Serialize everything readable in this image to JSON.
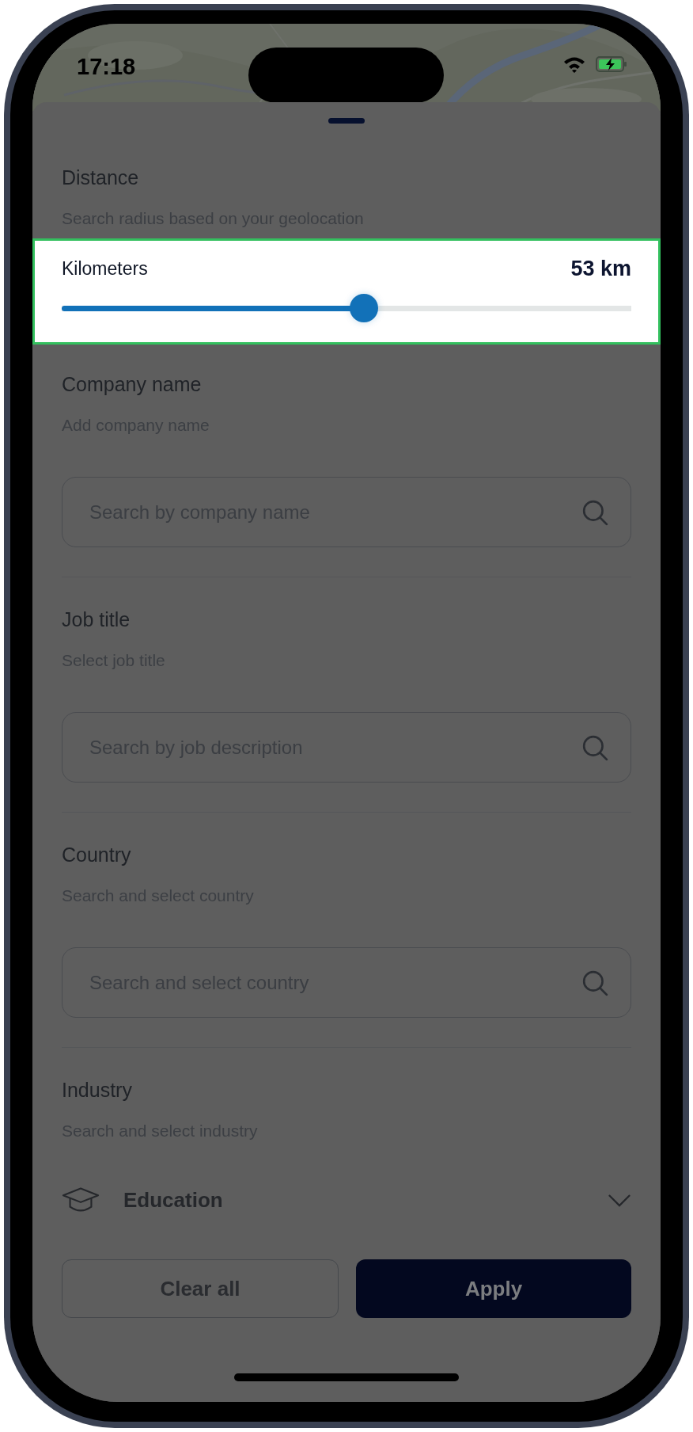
{
  "status_bar": {
    "time": "17:18"
  },
  "sections": [
    {
      "kind": "slider",
      "title": "Distance",
      "subtitle": "Search radius based on your geolocation",
      "slider": {
        "label": "Kilometers",
        "reading": "53 km",
        "level": 0.53,
        "highlighted": true
      }
    },
    {
      "kind": "search",
      "title": "Company name",
      "subtitle": "Add company name",
      "placeholder": "Search by company name"
    },
    {
      "kind": "search",
      "title": "Job title",
      "subtitle": "Select job title",
      "placeholder": "Search by job description"
    },
    {
      "kind": "search",
      "title": "Country",
      "subtitle": "Search and select country",
      "placeholder": "Search and select country"
    },
    {
      "kind": "select",
      "title": "Industry",
      "subtitle": "Search and select industry",
      "value": "Education"
    }
  ],
  "buttons": [
    {
      "label": "Clear all",
      "kind": "secondary"
    },
    {
      "label": "Apply",
      "kind": "primary"
    }
  ]
}
